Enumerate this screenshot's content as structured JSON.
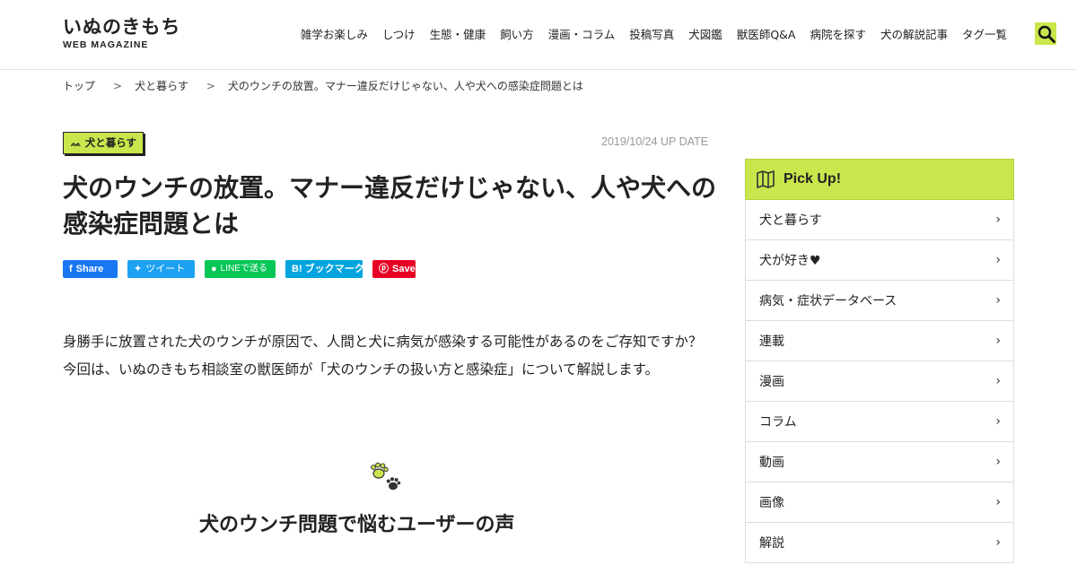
{
  "header": {
    "logo_main": "いぬのきもち",
    "logo_sub": "WEB MAGAZINE",
    "nav": [
      "雑学お楽しみ",
      "しつけ",
      "生態・健康",
      "飼い方",
      "漫画・コラム",
      "投稿写真",
      "犬図鑑",
      "獣医師Q&A",
      "病院を探す",
      "犬の解説記事",
      "タグ一覧"
    ],
    "search_icon": "search-icon",
    "accent": "#c9e64c"
  },
  "breadcrumb": {
    "items": [
      "トップ",
      "犬と暮らす",
      "犬のウンチの放置。マナー違反だけじゃない、人や犬への感染症問題とは"
    ],
    "separator": ">"
  },
  "article": {
    "category": "犬と暮らす",
    "date": "2019/10/24 UP DATE",
    "title": "犬のウンチの放置。マナー違反だけじゃない、人や犬への感染症問題とは",
    "share": {
      "facebook": "Share",
      "twitter": "ツイート",
      "line": "LINEで送る",
      "hatena": "B! ブックマーク",
      "pinterest": "Save"
    },
    "lead": "身勝手に放置された犬のウンチが原因で、人間と犬に病気が感染する可能性があるのをご存知ですか？今回は、いぬのきもち相談室の獣医師が「犬のウンチの扱い方と感染症」について解説します。",
    "section_title": "犬のウンチ問題で悩むユーザーの声"
  },
  "sidebar": {
    "heading": "Pick Up!",
    "items": [
      "犬と暮らす",
      "犬が好き♥",
      "病気・症状データベース",
      "連載",
      "漫画",
      "コラム",
      "動画",
      "画像",
      "解説"
    ]
  }
}
